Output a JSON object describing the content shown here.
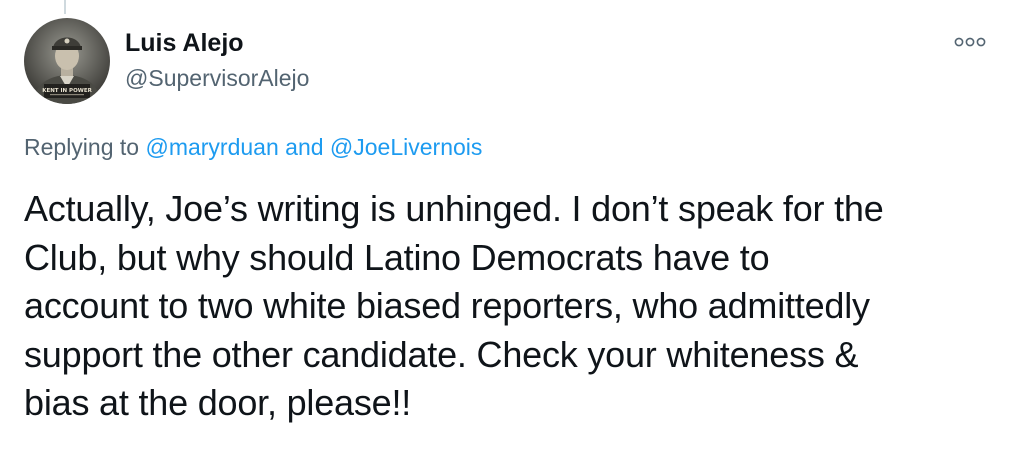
{
  "tweet": {
    "author": {
      "display_name": "Luis Alejo",
      "handle": "@SupervisorAlejo",
      "avatar_icon": "portrait-photo-icon",
      "avatar_caption": "KENT IN POWER"
    },
    "more_icon": "more-options-icon",
    "replying": {
      "prefix": "Replying to",
      "mention_1": "@maryrduan",
      "conjunction": "and",
      "mention_2": "@JoeLivernois"
    },
    "body_lines": [
      "Actually, Joe’s writing is unhinged. I don’t speak for the",
      "Club, but why should Latino Democrats have to",
      "account to two white biased reporters, who admittedly",
      "support the other candidate. Check your whiteness &",
      "bias at the door, please!!"
    ]
  },
  "colors": {
    "text": "#0f1419",
    "secondary": "#536471",
    "link": "#1d9bf0",
    "thread_line": "#cfd9de"
  }
}
